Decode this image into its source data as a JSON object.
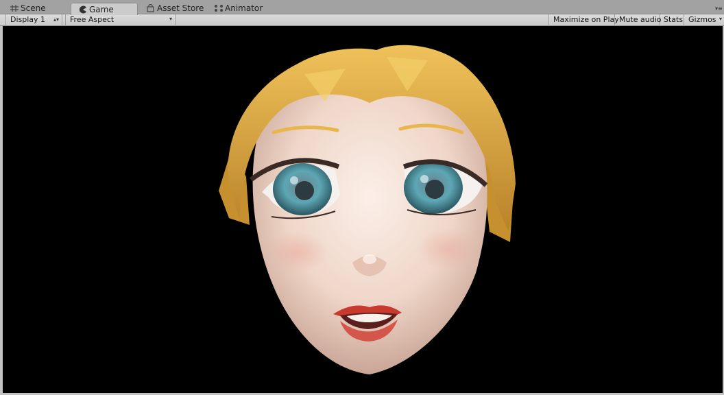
{
  "tabs": [
    {
      "label": "Scene",
      "icon": "scene-grid-icon"
    },
    {
      "label": "Game",
      "icon": "game-pacman-icon",
      "active": true
    },
    {
      "label": "Asset Store",
      "icon": "asset-store-bag-icon"
    },
    {
      "label": "Animator",
      "icon": "animator-nodes-icon"
    }
  ],
  "toolbar": {
    "display": "Display 1",
    "aspect": "Free Aspect",
    "maximize_on_play": "Maximize on Play",
    "mute_audio": "Mute audio",
    "stats": "Stats",
    "gizmos": "Gizmos"
  },
  "viewport": {
    "background": "#000000",
    "content": "character-head-render",
    "colors": {
      "hair": "#d9a53a",
      "skin": "#f1dcd0",
      "iris": "#5a97a6",
      "lips": "#c83a2e"
    }
  }
}
